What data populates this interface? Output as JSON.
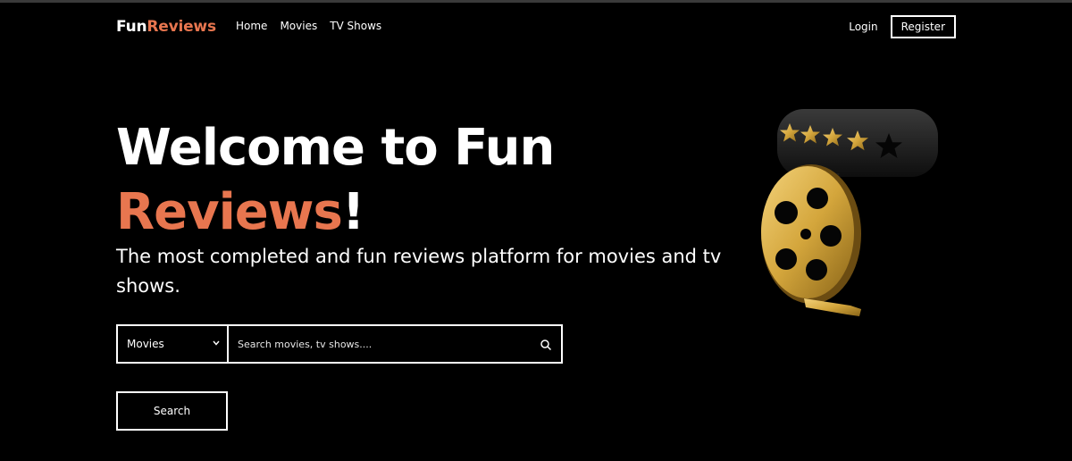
{
  "brand": {
    "part1": "Fun",
    "part2": "Reviews"
  },
  "nav": {
    "home": "Home",
    "movies": "Movies",
    "tv_shows": "TV Shows"
  },
  "auth": {
    "login": "Login",
    "register": "Register"
  },
  "hero": {
    "title_line1": "Welcome to Fun",
    "title_accent": "Reviews",
    "title_end": "!",
    "subtitle": "The most completed and fun reviews platform for movies and tv shows."
  },
  "search": {
    "category_selected": "Movies",
    "placeholder": "Search movies, tv shows....",
    "button_label": "Search"
  },
  "illustration": {
    "rating_stars_filled": 4,
    "rating_stars_total": 5
  },
  "colors": {
    "accent": "#e8764f",
    "background": "#000000",
    "gold": "#d4a63c"
  }
}
